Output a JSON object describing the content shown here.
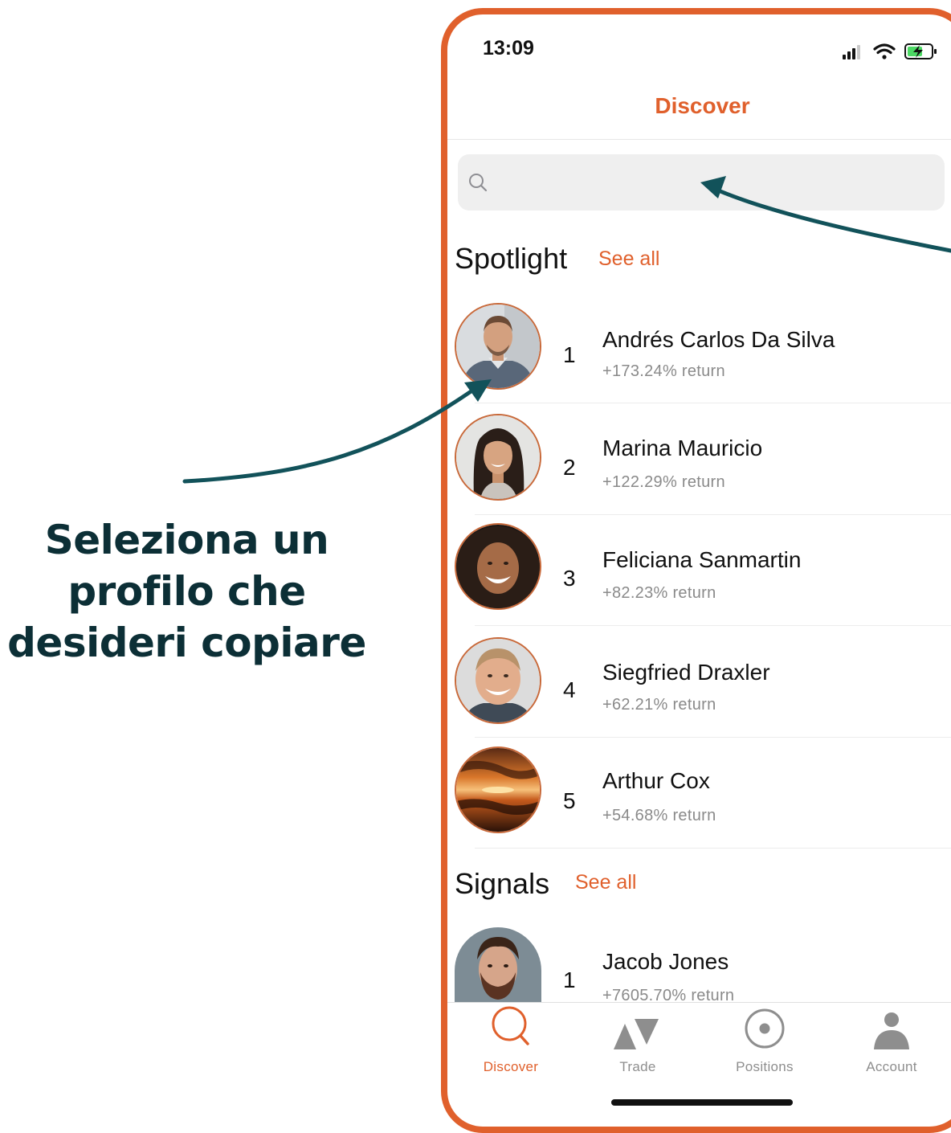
{
  "annotation": {
    "lines": [
      "Seleziona un",
      "profilo che",
      "desideri copiare"
    ]
  },
  "status_bar": {
    "time": "13:09"
  },
  "nav": {
    "title": "Discover"
  },
  "search": {
    "placeholder": ""
  },
  "spotlight": {
    "title": "Spotlight",
    "see_all": "See all",
    "traders": [
      {
        "rank": "1",
        "name": "Andrés Carlos Da Silva",
        "return": "+173.24% return"
      },
      {
        "rank": "2",
        "name": "Marina Mauricio",
        "return": "+122.29% return"
      },
      {
        "rank": "3",
        "name": "Feliciana Sanmartin",
        "return": "+82.23% return"
      },
      {
        "rank": "4",
        "name": "Siegfried Draxler",
        "return": "+62.21% return"
      },
      {
        "rank": "5",
        "name": "Arthur Cox",
        "return": "+54.68% return"
      }
    ]
  },
  "signals": {
    "title": "Signals",
    "see_all": "See all",
    "traders": [
      {
        "rank": "1",
        "name": "Jacob Jones",
        "return": "+7605.70% return"
      }
    ]
  },
  "tabbar": {
    "tabs": [
      {
        "label": "Discover",
        "icon": "search-icon",
        "active": true
      },
      {
        "label": "Trade",
        "icon": "trade-icon",
        "active": false
      },
      {
        "label": "Positions",
        "icon": "positions-icon",
        "active": false
      },
      {
        "label": "Account",
        "icon": "account-icon",
        "active": false
      }
    ]
  },
  "colors": {
    "accent": "#e0602c",
    "annotation_text": "#0c2f36",
    "arrow": "#12525a",
    "secondary_text": "#8a8a8a"
  }
}
